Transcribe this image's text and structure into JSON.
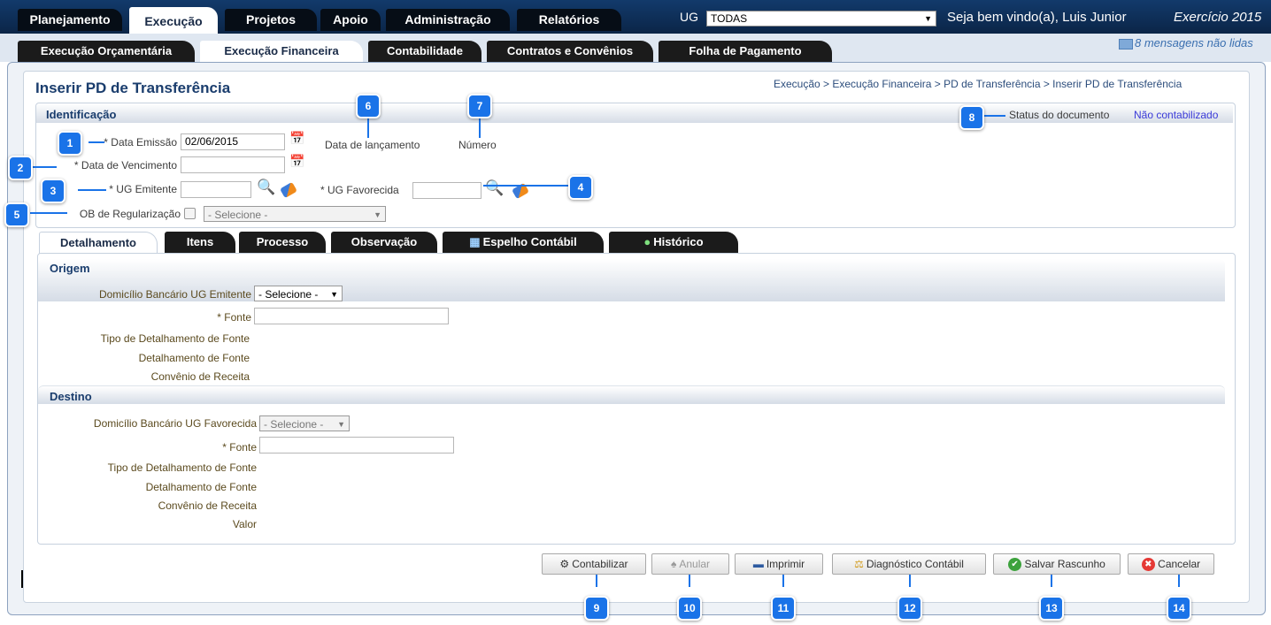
{
  "top_nav": {
    "tabs": [
      "Planejamento",
      "Execução",
      "Projetos",
      "Apoio",
      "Administração",
      "Relatórios"
    ],
    "active_tab": "Execução",
    "ug_label": "UG",
    "ug_value": "TODAS",
    "welcome": "Seja bem vindo(a), Luis Junior",
    "exercise": "Exercício 2015"
  },
  "sub_nav": {
    "tabs": [
      "Execução Orçamentária",
      "Execução Financeira",
      "Contabilidade",
      "Contratos e Convênios",
      "Folha de Pagamento"
    ],
    "active_tab": "Execução Financeira",
    "messages": "8 mensagens não lidas"
  },
  "page": {
    "title": "Inserir PD de Transferência",
    "breadcrumb": "Execução > Execução Financeira > PD de Transferência > Inserir PD de Transferência"
  },
  "identificacao": {
    "title": "Identificação",
    "data_emissao_label": "* Data Emissão",
    "data_emissao_value": "02/06/2015",
    "data_lancamento_label": "Data de lançamento",
    "numero_label": "Número",
    "status_label": "Status do documento",
    "status_value": "Não contabilizado",
    "data_vencimento_label": "* Data de Vencimento",
    "data_vencimento_value": "",
    "ug_emitente_label": "* UG Emitente",
    "ug_emitente_value": "",
    "ug_favorecida_label": "* UG Favorecida",
    "ug_favorecida_value": "",
    "ob_regularizacao_label": "OB de Regularização",
    "ob_select_value": "- Selecione -"
  },
  "detail_tabs": [
    "Detalhamento",
    "Itens",
    "Processo",
    "Observação",
    "Espelho Contábil",
    "Histórico"
  ],
  "detail_active": "Detalhamento",
  "origem": {
    "title": "Origem",
    "domicilio_label": "Domicílio Bancário UG Emitente",
    "domicilio_value": "- Selecione -",
    "fonte_label": "* Fonte",
    "fonte_value": "",
    "tipo_detalhamento_label": "Tipo de Detalhamento de Fonte",
    "detalhamento_label": "Detalhamento de Fonte",
    "convenio_label": "Convênio de Receita"
  },
  "destino": {
    "title": "Destino",
    "domicilio_label": "Domicílio Bancário UG Favorecida",
    "domicilio_value": "- Selecione -",
    "fonte_label": "* Fonte",
    "fonte_value": "",
    "tipo_detalhamento_label": "Tipo de Detalhamento de Fonte",
    "detalhamento_label": "Detalhamento de Fonte",
    "convenio_label": "Convênio de Receita",
    "valor_label": "Valor"
  },
  "buttons": {
    "contabilizar": "Contabilizar",
    "anular": "Anular",
    "imprimir": "Imprimir",
    "diagnostico": "Diagnóstico Contábil",
    "salvar": "Salvar Rascunho",
    "cancelar": "Cancelar"
  },
  "badges": [
    "1",
    "2",
    "3",
    "4",
    "5",
    "6",
    "7",
    "8",
    "9",
    "10",
    "11",
    "12",
    "13",
    "14"
  ],
  "colors": {
    "badge": "#1a73e8",
    "title": "#1a3d6d",
    "status_value": "#3a3ad8",
    "top_bar": "#0d2a4f"
  }
}
